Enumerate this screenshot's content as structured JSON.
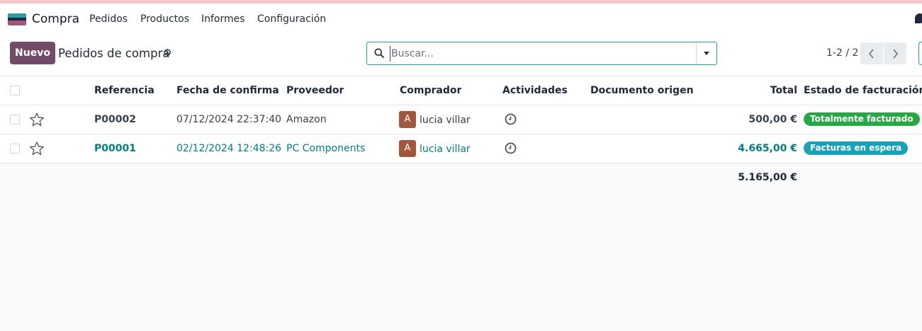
{
  "navbar": {
    "app_name": "Compra",
    "menu": [
      "Pedidos",
      "Productos",
      "Informes",
      "Configuración"
    ]
  },
  "control": {
    "new_label": "Nuevo",
    "breadcrumb": "Pedidos de compra",
    "search_placeholder": "Buscar...",
    "pager": "1-2 / 2"
  },
  "table": {
    "columns": [
      "Referencia",
      "Fecha de confirmaci...",
      "Proveedor",
      "Comprador",
      "Actividades",
      "Documento origen",
      "Total",
      "Estado de facturación"
    ],
    "rows": [
      {
        "reference": "P00002",
        "date": "07/12/2024 22:37:40",
        "vendor": "Amazon",
        "buyer_initial": "A",
        "buyer": "lucia villar",
        "source_document": "",
        "total": "500,00 €",
        "billing_status": "Totalmente facturado",
        "billing_color": "#28a745"
      },
      {
        "reference": "P00001",
        "date": "02/12/2024 12:48:26",
        "vendor": "PC Components",
        "buyer_initial": "A",
        "buyer": "lucia villar",
        "source_document": "",
        "total": "4.665,00 €",
        "billing_status": "Facturas en espera",
        "billing_color": "#17a2b8"
      }
    ],
    "grand_total": "5.165,00 €"
  },
  "colors": {
    "primary": "#714b67",
    "accent": "#017e84"
  }
}
